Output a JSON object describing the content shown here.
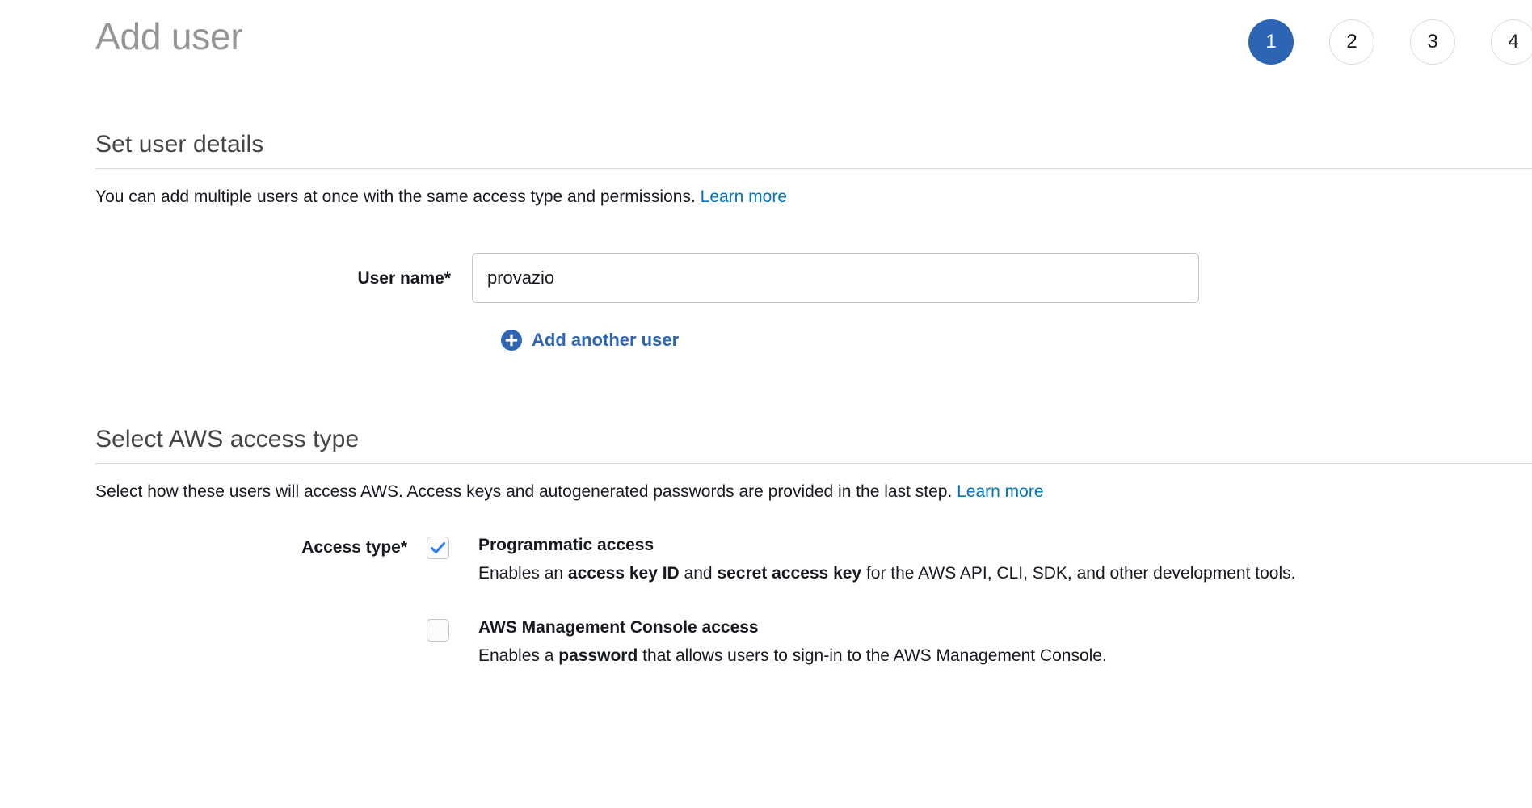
{
  "header": {
    "title": "Add user",
    "steps": [
      {
        "label": "1",
        "state": "active"
      },
      {
        "label": "2",
        "state": "inactive"
      },
      {
        "label": "3",
        "state": "inactive"
      },
      {
        "label": "4",
        "state": "inactive"
      }
    ]
  },
  "colors": {
    "accent_blue": "#2d64b3",
    "link_blue": "#0073bb",
    "title_gray": "#969696",
    "divider": "#d5dbdb",
    "text": "#16191f"
  },
  "user_details": {
    "heading": "Set user details",
    "description_text": "You can add multiple users at once with the same access type and permissions.",
    "learn_more": "Learn more",
    "username_label": "User name*",
    "username_value": "provazio",
    "username_placeholder": "",
    "add_another_icon": "plus-circle-icon",
    "add_another_label": "Add another user"
  },
  "access_type": {
    "heading": "Select AWS access type",
    "description_text": "Select how these users will access AWS. Access keys and autogenerated passwords are provided in the last step.",
    "learn_more": "Learn more",
    "label": "Access type*",
    "options": [
      {
        "title": "Programmatic access",
        "checked": true,
        "desc_parts": [
          {
            "text": "Enables an ",
            "bold": false
          },
          {
            "text": "access key ID",
            "bold": true
          },
          {
            "text": " and ",
            "bold": false
          },
          {
            "text": "secret access key",
            "bold": true
          },
          {
            "text": " for the AWS API, CLI, SDK, and other development tools.",
            "bold": false
          }
        ]
      },
      {
        "title": "AWS Management Console access",
        "checked": false,
        "desc_parts": [
          {
            "text": "Enables a ",
            "bold": false
          },
          {
            "text": "password",
            "bold": true
          },
          {
            "text": " that allows users to sign-in to the AWS Management Console.",
            "bold": false
          }
        ]
      }
    ]
  }
}
